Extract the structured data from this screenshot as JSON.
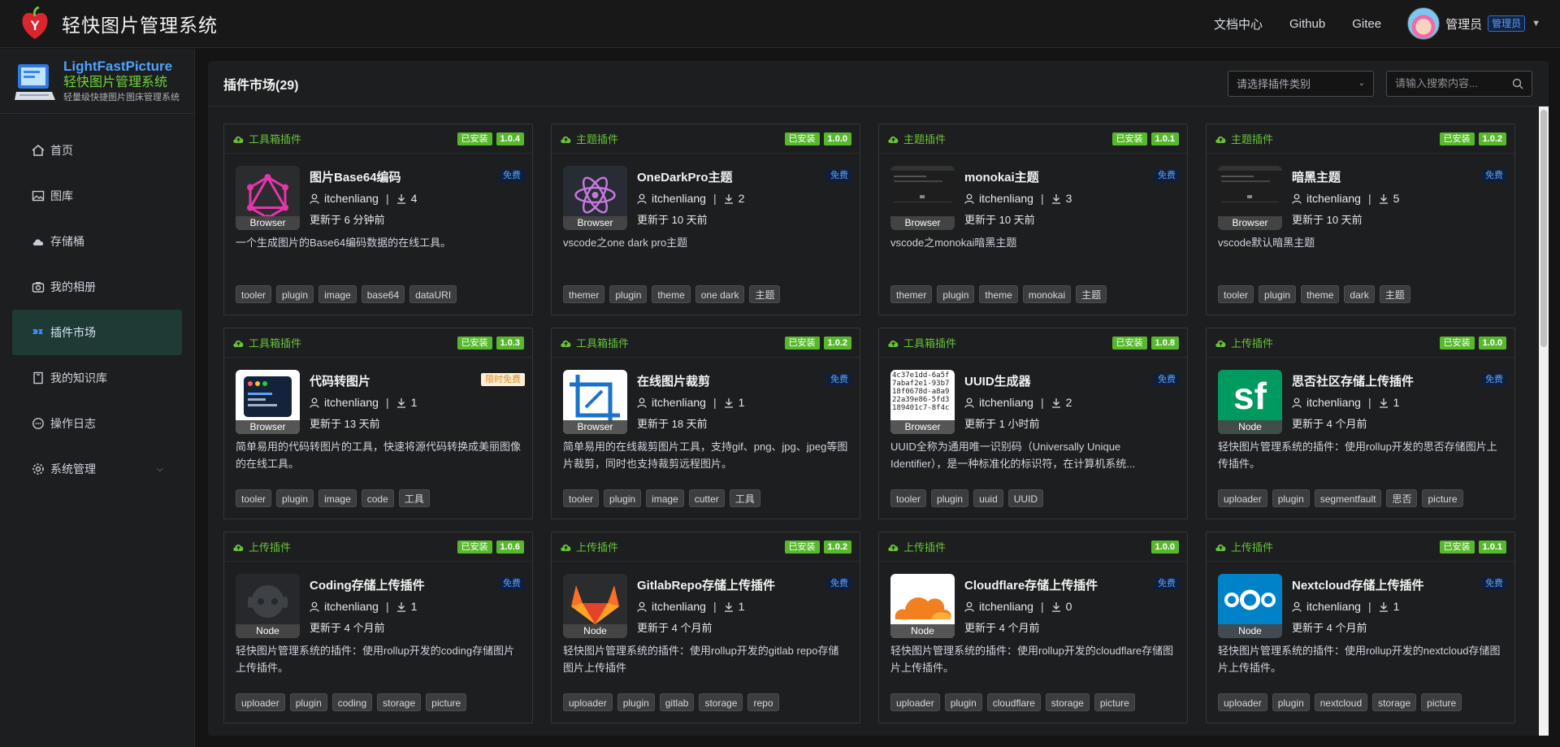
{
  "header": {
    "app_title": "轻快图片管理系统",
    "links": [
      "文档中心",
      "Github",
      "Gitee"
    ],
    "user_name": "管理员",
    "user_role": "管理员"
  },
  "sidebar": {
    "brand_en": "LightFastPicture",
    "brand_cn": "轻快图片管理系统",
    "brand_sub": "轻量级快捷图片图床管理系统",
    "items": [
      {
        "label": "首页",
        "icon": "home-icon"
      },
      {
        "label": "图库",
        "icon": "gallery-icon"
      },
      {
        "label": "存储桶",
        "icon": "cloud-icon"
      },
      {
        "label": "我的相册",
        "icon": "camera-icon"
      },
      {
        "label": "插件市场",
        "icon": "plugin-icon",
        "active": true
      },
      {
        "label": "我的知识库",
        "icon": "book-icon"
      },
      {
        "label": "操作日志",
        "icon": "chat-icon"
      },
      {
        "label": "系统管理",
        "icon": "gear-icon",
        "has_submenu": true
      }
    ]
  },
  "main": {
    "title": "插件市场(29)",
    "category_select_placeholder": "请选择插件类别",
    "search_placeholder": "请输入搜索内容...",
    "cards": [
      {
        "category": "工具箱插件",
        "installed": "已安装",
        "version": "1.0.4",
        "name": "图片Base64编码",
        "price": "免费",
        "author": "itchenliang",
        "downloads": "4",
        "updated": "更新于 6 分钟前",
        "platform": "Browser",
        "thumb": "graphql",
        "desc": "一个生成图片的Base64编码数据的在线工具。",
        "tags": [
          "tooler",
          "plugin",
          "image",
          "base64",
          "dataURI"
        ]
      },
      {
        "category": "主题插件",
        "installed": "已安装",
        "version": "1.0.0",
        "name": "OneDarkPro主题",
        "price": "免费",
        "author": "itchenliang",
        "downloads": "2",
        "updated": "更新于 10 天前",
        "platform": "Browser",
        "thumb": "atom",
        "desc": "vscode之one dark pro主题",
        "tags": [
          "themer",
          "plugin",
          "theme",
          "one dark",
          "主题"
        ]
      },
      {
        "category": "主题插件",
        "installed": "已安装",
        "version": "1.0.1",
        "name": "monokai主题",
        "price": "免费",
        "author": "itchenliang",
        "downloads": "3",
        "updated": "更新于 10 天前",
        "platform": "Browser",
        "thumb": "dark",
        "desc": "vscode之monokai暗黑主题",
        "tags": [
          "themer",
          "plugin",
          "theme",
          "monokai",
          "主题"
        ]
      },
      {
        "category": "主题插件",
        "installed": "已安装",
        "version": "1.0.2",
        "name": "暗黑主题",
        "price": "免费",
        "author": "itchenliang",
        "downloads": "5",
        "updated": "更新于 10 天前",
        "platform": "Browser",
        "thumb": "dark",
        "desc": "vscode默认暗黑主题",
        "tags": [
          "tooler",
          "plugin",
          "theme",
          "dark",
          "主题"
        ]
      },
      {
        "category": "工具箱插件",
        "installed": "已安装",
        "version": "1.0.3",
        "name": "代码转图片",
        "price": "限时免费",
        "price_limited": true,
        "author": "itchenliang",
        "downloads": "1",
        "updated": "更新于 13 天前",
        "platform": "Browser",
        "thumb": "code",
        "desc": "简单易用的代码转图片的工具，快速将源代码转换成美丽图像的在线工具。",
        "tags": [
          "tooler",
          "plugin",
          "image",
          "code",
          "工具"
        ]
      },
      {
        "category": "工具箱插件",
        "installed": "已安装",
        "version": "1.0.2",
        "name": "在线图片裁剪",
        "price": "免费",
        "author": "itchenliang",
        "downloads": "1",
        "updated": "更新于 18 天前",
        "platform": "Browser",
        "thumb": "crop",
        "desc": "简单易用的在线裁剪图片工具，支持gif、png、jpg、jpeg等图片裁剪，同时也支持裁剪远程图片。",
        "tags": [
          "tooler",
          "plugin",
          "image",
          "cutter",
          "工具"
        ]
      },
      {
        "category": "工具箱插件",
        "installed": "已安装",
        "version": "1.0.8",
        "name": "UUID生成器",
        "price": "免费",
        "author": "itchenliang",
        "downloads": "2",
        "updated": "更新于 1 小时前",
        "platform": "Browser",
        "thumb": "uuid",
        "thumb_text": "4c37e1dd-6a5f 7abaf2e1-93b7 18f0678d-a8a9 22a39e86-5fd3 189401c7-8f4c",
        "desc": "UUID全称为通用唯一识别码（Universally Unique Identifier），是一种标准化的标识符，在计算机系统...",
        "tags": [
          "tooler",
          "plugin",
          "uuid",
          "UUID"
        ]
      },
      {
        "category": "上传插件",
        "installed": "已安装",
        "version": "1.0.0",
        "name": "思否社区存储上传插件",
        "price": "免费",
        "author": "itchenliang",
        "downloads": "1",
        "updated": "更新于 4 个月前",
        "platform": "Node",
        "thumb": "sf",
        "thumb_text": "sf",
        "desc": "轻快图片管理系统的插件：使用rollup开发的思否存储图片上传插件。",
        "tags": [
          "uploader",
          "plugin",
          "segmentfault",
          "思否",
          "picture"
        ]
      },
      {
        "category": "上传插件",
        "installed": "已安装",
        "version": "1.0.6",
        "name": "Coding存储上传插件",
        "price": "免费",
        "author": "itchenliang",
        "downloads": "1",
        "updated": "更新于 4 个月前",
        "platform": "Node",
        "thumb": "coding",
        "desc": "轻快图片管理系统的插件：使用rollup开发的coding存储图片上传插件。",
        "tags": [
          "uploader",
          "plugin",
          "coding",
          "storage",
          "picture"
        ]
      },
      {
        "category": "上传插件",
        "installed": "已安装",
        "version": "1.0.2",
        "name": "GitlabRepo存储上传插件",
        "price": "免费",
        "author": "itchenliang",
        "downloads": "1",
        "updated": "更新于 4 个月前",
        "platform": "Node",
        "thumb": "gitlab",
        "desc": "轻快图片管理系统的插件：使用rollup开发的gitlab repo存储图片上传插件",
        "tags": [
          "uploader",
          "plugin",
          "gitlab",
          "storage",
          "repo"
        ]
      },
      {
        "category": "上传插件",
        "installed": "",
        "version": "1.0.0",
        "name": "Cloudflare存储上传插件",
        "price": "免费",
        "author": "itchenliang",
        "downloads": "0",
        "updated": "更新于 4 个月前",
        "platform": "Node",
        "thumb": "cloudflare",
        "desc": "轻快图片管理系统的插件：使用rollup开发的cloudflare存储图片上传插件。",
        "tags": [
          "uploader",
          "plugin",
          "cloudflare",
          "storage",
          "picture"
        ]
      },
      {
        "category": "上传插件",
        "installed": "已安装",
        "version": "1.0.1",
        "name": "Nextcloud存储上传插件",
        "price": "免费",
        "author": "itchenliang",
        "downloads": "1",
        "updated": "更新于 4 个月前",
        "platform": "Node",
        "thumb": "nextcloud",
        "desc": "轻快图片管理系统的插件：使用rollup开发的nextcloud存储图片上传插件。",
        "tags": [
          "uploader",
          "plugin",
          "nextcloud",
          "storage",
          "picture"
        ]
      }
    ]
  }
}
